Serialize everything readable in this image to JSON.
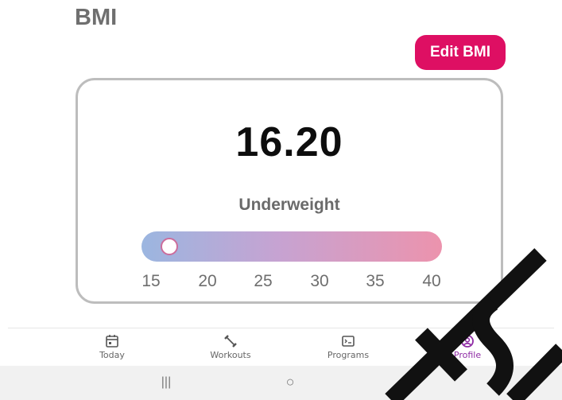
{
  "header": {
    "title": "BMI"
  },
  "edit_button": {
    "label": "Edit BMI",
    "color": "#de0f63"
  },
  "bmi_card": {
    "value": "16.20",
    "category": "Underweight",
    "scale": {
      "min": 15,
      "max": 40,
      "current": 16.2,
      "tick_labels": [
        "15",
        "20",
        "25",
        "30",
        "35",
        "40"
      ],
      "gradient_colors": [
        "#9bb6e0",
        "#c6a3d2",
        "#ec93ad"
      ]
    }
  },
  "bottom_nav": {
    "items": [
      {
        "label": "Today",
        "icon": "calendar-icon",
        "active": false
      },
      {
        "label": "Workouts",
        "icon": "dumbbell-icon",
        "active": false
      },
      {
        "label": "Programs",
        "icon": "terminal-icon",
        "active": false
      },
      {
        "label": "Profile",
        "icon": "profile-icon",
        "active": true
      }
    ],
    "active_color": "#8f2ca5"
  },
  "system_nav": {
    "recent": "|||",
    "home": "○",
    "back": "<"
  },
  "watermark": {
    "text": "TSM"
  }
}
